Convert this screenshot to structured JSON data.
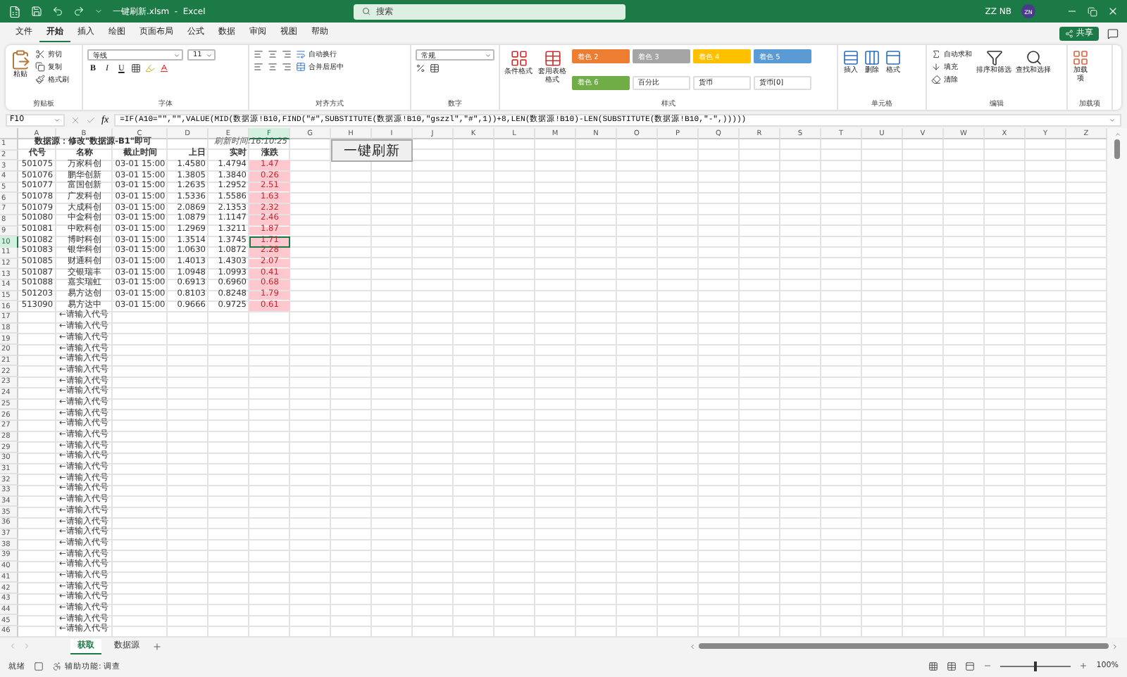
{
  "title_bar": {
    "title": "一键刷新.xlsm  -  Excel",
    "search_placeholder": "搜索",
    "user": "ZZ NB",
    "avatar": "ZN"
  },
  "menu_tabs": [
    {
      "label": "文件",
      "selected": false
    },
    {
      "label": "开始",
      "selected": true
    },
    {
      "label": "插入",
      "selected": false
    },
    {
      "label": "绘图",
      "selected": false
    },
    {
      "label": "页面布局",
      "selected": false
    },
    {
      "label": "公式",
      "selected": false
    },
    {
      "label": "数据",
      "selected": false
    },
    {
      "label": "审阅",
      "selected": false
    },
    {
      "label": "视图",
      "selected": false
    },
    {
      "label": "帮助",
      "selected": false
    }
  ],
  "share_button": "共享",
  "ribbon": {
    "groups": [
      {
        "kind": "clipboard",
        "label": "剪贴板",
        "big": "粘贴",
        "items": [
          "剪切",
          "复制",
          "格式刷"
        ]
      },
      {
        "kind": "font",
        "label": "字体",
        "font": "等线",
        "size": "11",
        "style_buttons": [
          "B",
          "I",
          "U"
        ]
      },
      {
        "kind": "alignment",
        "label": "对齐方式",
        "items": [
          "自动换行",
          "合并后居中"
        ]
      },
      {
        "kind": "number",
        "label": "数字",
        "format": "常规"
      },
      {
        "kind": "styles",
        "label": "样式",
        "big": [
          "条件格式",
          "套用表格格式"
        ],
        "cell_styles": [
          {
            "label": "着色 2",
            "color": "#ed7d31"
          },
          {
            "label": "着色 3",
            "color": "#a5a5a5"
          },
          {
            "label": "着色 4",
            "color": "#ffc000"
          },
          {
            "label": "着色 5",
            "color": "#5b9bd5"
          },
          {
            "label": "着色 6",
            "color": "#70ad47"
          },
          {
            "label": "百分比"
          },
          {
            "label": "货币"
          },
          {
            "label": "货币[0]"
          }
        ]
      },
      {
        "kind": "cells",
        "label": "单元格",
        "big": [
          "插入",
          "删除",
          "格式"
        ]
      },
      {
        "kind": "editing",
        "label": "编辑",
        "items": [
          "自动求和",
          "填充",
          "清除"
        ],
        "big": [
          "排序和筛选",
          "查找和选择"
        ]
      },
      {
        "kind": "addins",
        "label": "加载项",
        "big": [
          "加载项"
        ]
      }
    ]
  },
  "formula_bar": {
    "name_box": "F10",
    "function_label": "fx",
    "formula": "=IF(A10=\"\",\"\",VALUE(MID(数据源!B10,FIND(\"#\",SUBSTITUTE(数据源!B10,\"gszzl\",\"#\",1))+8,LEN(数据源!B10)-LEN(SUBSTITUTE(数据源!B10,\"-\",)))))"
  },
  "columns": [
    {
      "label": "A",
      "selected": false
    },
    {
      "label": "B",
      "selected": false
    },
    {
      "label": "C",
      "selected": false
    },
    {
      "label": "D",
      "selected": false
    },
    {
      "label": "E",
      "selected": false
    },
    {
      "label": "F",
      "selected": true
    },
    {
      "label": "G",
      "selected": false
    },
    {
      "label": "H",
      "selected": false
    },
    {
      "label": "I",
      "selected": false
    },
    {
      "label": "J",
      "selected": false
    },
    {
      "label": "K",
      "selected": false
    },
    {
      "label": "L",
      "selected": false
    },
    {
      "label": "M",
      "selected": false
    },
    {
      "label": "N",
      "selected": false
    },
    {
      "label": "O",
      "selected": false
    },
    {
      "label": "P",
      "selected": false
    },
    {
      "label": "Q",
      "selected": false
    },
    {
      "label": "R",
      "selected": false
    },
    {
      "label": "S",
      "selected": false
    },
    {
      "label": "T",
      "selected": false
    },
    {
      "label": "U",
      "selected": false
    },
    {
      "label": "V",
      "selected": false
    },
    {
      "label": "W",
      "selected": false
    },
    {
      "label": "X",
      "selected": false
    },
    {
      "label": "Y",
      "selected": false
    },
    {
      "label": "Z",
      "selected": false
    }
  ],
  "rows": [
    {
      "number": "1",
      "selected": false,
      "kind": "title",
      "note": "数据源：修改\"数据源-B1\"即可",
      "refresh_time": "刷新时间:16:10:25"
    },
    {
      "number": "2",
      "selected": false,
      "kind": "header",
      "cells": [
        "代号",
        "名称",
        "截止时间",
        "上日",
        "实时",
        "涨跌"
      ]
    },
    {
      "number": "3",
      "selected": false,
      "kind": "data",
      "cells": [
        "501075",
        "万家科创",
        "03-01 15:00",
        "1.4580",
        "1.4794",
        "1.47"
      ]
    },
    {
      "number": "4",
      "selected": false,
      "kind": "data",
      "cells": [
        "501076",
        "鹏华创新",
        "03-01 15:00",
        "1.3805",
        "1.3840",
        "0.26"
      ]
    },
    {
      "number": "5",
      "selected": false,
      "kind": "data",
      "cells": [
        "501077",
        "富国创新",
        "03-01 15:00",
        "1.2635",
        "1.2952",
        "2.51"
      ]
    },
    {
      "number": "6",
      "selected": false,
      "kind": "data",
      "cells": [
        "501078",
        "广发科创",
        "03-01 15:00",
        "1.5336",
        "1.5586",
        "1.63"
      ]
    },
    {
      "number": "7",
      "selected": false,
      "kind": "data",
      "cells": [
        "501079",
        "大成科创",
        "03-01 15:00",
        "2.0869",
        "2.1353",
        "2.32"
      ]
    },
    {
      "number": "8",
      "selected": false,
      "kind": "data",
      "cells": [
        "501080",
        "中金科创",
        "03-01 15:00",
        "1.0879",
        "1.1147",
        "2.46"
      ]
    },
    {
      "number": "9",
      "selected": false,
      "kind": "data",
      "cells": [
        "501081",
        "中欧科创",
        "03-01 15:00",
        "1.2969",
        "1.3211",
        "1.87"
      ]
    },
    {
      "number": "10",
      "selected": true,
      "kind": "data",
      "cells": [
        "501082",
        "博时科创",
        "03-01 15:00",
        "1.3514",
        "1.3745",
        "1.71"
      ]
    },
    {
      "number": "11",
      "selected": false,
      "kind": "data",
      "cells": [
        "501083",
        "银华科创",
        "03-01 15:00",
        "1.0630",
        "1.0872",
        "2.28"
      ]
    },
    {
      "number": "12",
      "selected": false,
      "kind": "data",
      "cells": [
        "501085",
        "财通科创",
        "03-01 15:00",
        "1.4013",
        "1.4303",
        "2.07"
      ]
    },
    {
      "number": "13",
      "selected": false,
      "kind": "data",
      "cells": [
        "501087",
        "交银瑞丰",
        "03-01 15:00",
        "1.0948",
        "1.0993",
        "0.41"
      ]
    },
    {
      "number": "14",
      "selected": false,
      "kind": "data",
      "cells": [
        "501088",
        "嘉实瑞虹",
        "03-01 15:00",
        "0.6913",
        "0.6960",
        "0.68"
      ]
    },
    {
      "number": "15",
      "selected": false,
      "kind": "data",
      "cells": [
        "501203",
        "易方达创",
        "03-01 15:00",
        "0.8103",
        "0.8248",
        "1.79"
      ]
    },
    {
      "number": "16",
      "selected": false,
      "kind": "data",
      "cells": [
        "513090",
        "易方达中",
        "03-01 15:00",
        "0.9666",
        "0.9725",
        "0.61"
      ]
    },
    {
      "number": "17",
      "selected": false,
      "kind": "prompt",
      "text": "←请输入代号"
    },
    {
      "number": "18",
      "selected": false,
      "kind": "prompt",
      "text": "←请输入代号"
    },
    {
      "number": "19",
      "selected": false,
      "kind": "prompt",
      "text": "←请输入代号"
    },
    {
      "number": "20",
      "selected": false,
      "kind": "prompt",
      "text": "←请输入代号"
    },
    {
      "number": "21",
      "selected": false,
      "kind": "prompt",
      "text": "←请输入代号"
    },
    {
      "number": "22",
      "selected": false,
      "kind": "prompt",
      "text": "←请输入代号"
    },
    {
      "number": "23",
      "selected": false,
      "kind": "prompt",
      "text": "←请输入代号"
    },
    {
      "number": "24",
      "selected": false,
      "kind": "prompt",
      "text": "←请输入代号"
    },
    {
      "number": "25",
      "selected": false,
      "kind": "prompt",
      "text": "←请输入代号"
    },
    {
      "number": "26",
      "selected": false,
      "kind": "prompt",
      "text": "←请输入代号"
    },
    {
      "number": "27",
      "selected": false,
      "kind": "prompt",
      "text": "←请输入代号"
    },
    {
      "number": "28",
      "selected": false,
      "kind": "prompt",
      "text": "←请输入代号"
    },
    {
      "number": "29",
      "selected": false,
      "kind": "prompt",
      "text": "←请输入代号"
    },
    {
      "number": "30",
      "selected": false,
      "kind": "prompt",
      "text": "←请输入代号"
    },
    {
      "number": "31",
      "selected": false,
      "kind": "prompt",
      "text": "←请输入代号"
    },
    {
      "number": "32",
      "selected": false,
      "kind": "prompt",
      "text": "←请输入代号"
    },
    {
      "number": "33",
      "selected": false,
      "kind": "prompt",
      "text": "←请输入代号"
    },
    {
      "number": "34",
      "selected": false,
      "kind": "prompt",
      "text": "←请输入代号"
    },
    {
      "number": "35",
      "selected": false,
      "kind": "prompt",
      "text": "←请输入代号"
    },
    {
      "number": "36",
      "selected": false,
      "kind": "prompt",
      "text": "←请输入代号"
    },
    {
      "number": "37",
      "selected": false,
      "kind": "prompt",
      "text": "←请输入代号"
    },
    {
      "number": "38",
      "selected": false,
      "kind": "prompt",
      "text": "←请输入代号"
    },
    {
      "number": "39",
      "selected": false,
      "kind": "prompt",
      "text": "←请输入代号"
    },
    {
      "number": "40",
      "selected": false,
      "kind": "prompt",
      "text": "←请输入代号"
    },
    {
      "number": "41",
      "selected": false,
      "kind": "prompt",
      "text": "←请输入代号"
    },
    {
      "number": "42",
      "selected": false,
      "kind": "prompt",
      "text": "←请输入代号"
    },
    {
      "number": "43",
      "selected": false,
      "kind": "prompt",
      "text": "←请输入代号"
    },
    {
      "number": "44",
      "selected": false,
      "kind": "prompt",
      "text": "←请输入代号"
    },
    {
      "number": "45",
      "selected": false,
      "kind": "prompt",
      "text": "←请输入代号"
    },
    {
      "number": "46",
      "selected": false,
      "kind": "prompt",
      "text": "←请输入代号"
    }
  ],
  "sheet_button": "一键刷新",
  "sheet_tabs": [
    {
      "label": "获取",
      "selected": true
    },
    {
      "label": "数据源",
      "selected": false
    }
  ],
  "status_bar": {
    "status": "就绪",
    "accessibility": "辅助功能: 调查",
    "zoom": "100%",
    "zoom_slider": {
      "level": 0.5
    }
  }
}
